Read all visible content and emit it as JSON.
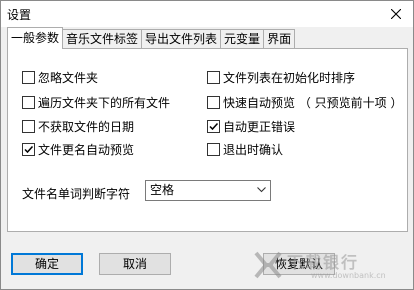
{
  "window": {
    "title": "设置"
  },
  "tabs": [
    {
      "label": "一般参数",
      "active": true
    },
    {
      "label": "音乐文件标签",
      "active": false
    },
    {
      "label": "导出文件列表",
      "active": false
    },
    {
      "label": "元变量",
      "active": false
    },
    {
      "label": "界面",
      "active": false
    }
  ],
  "checkboxes": [
    {
      "label": "忽略文件夹",
      "checked": false
    },
    {
      "label": "遍历文件夹下的所有文件",
      "checked": false
    },
    {
      "label": "不获取文件的日期",
      "checked": false
    },
    {
      "label": "文件更名自动预览",
      "checked": true
    },
    {
      "label": "文件列表在初始化时排序",
      "checked": false
    },
    {
      "label": "快速自动预览 （ 只预览前十项 ）",
      "checked": false
    },
    {
      "label": "自动更正错误",
      "checked": true
    },
    {
      "label": "退出时确认",
      "checked": false
    }
  ],
  "separator": {
    "label": "文件名单词判断字符",
    "selected": "空格"
  },
  "buttons": {
    "ok": "确定",
    "cancel": "取消",
    "restore_defaults": "恢复默认"
  },
  "watermark": {
    "text": "下载银行",
    "url": "www.downbank.cn"
  }
}
